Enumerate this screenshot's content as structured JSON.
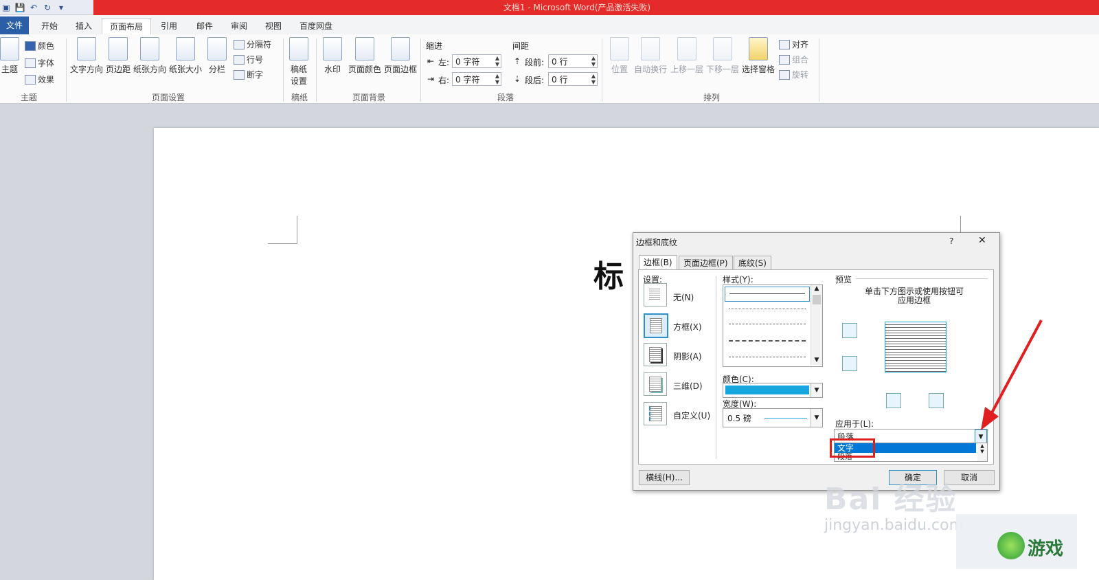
{
  "window": {
    "title": "文档1 - Microsoft Word(产品激活失败)"
  },
  "tabs": [
    "文件",
    "开始",
    "插入",
    "页面布局",
    "引用",
    "邮件",
    "审阅",
    "视图",
    "百度网盘"
  ],
  "ribbon": {
    "theme": {
      "big": "主题",
      "colors": "颜色",
      "fonts": "字体",
      "effects": "效果",
      "group": "主题"
    },
    "page_setup": {
      "text_dir": "文字方向",
      "margins": "页边距",
      "orientation": "纸张方向",
      "size": "纸张大小",
      "columns": "分栏",
      "breaks": "分隔符",
      "line_numbers": "行号",
      "hyphenation": "断字",
      "group": "页面设置"
    },
    "draft": {
      "btn1": "稿纸",
      "btn2": "设置",
      "group": "稿纸"
    },
    "bg": {
      "watermark": "水印",
      "page_color": "页面颜色",
      "page_border": "页面边框",
      "group": "页面背景"
    },
    "para": {
      "indent": "缩进",
      "left": "左:",
      "right": "右:",
      "left_val": "0 字符",
      "right_val": "0 字符",
      "spacing": "间距",
      "before": "段前:",
      "after": "段后:",
      "before_val": "0 行",
      "after_val": "0 行",
      "group": "段落"
    },
    "arrange": {
      "position": "位置",
      "wrap": "自动换行",
      "forward": "上移一层",
      "backward": "下移一层",
      "pane": "选择窗格",
      "align": "对齐",
      "group_btn": "组合",
      "rotate": "旋转",
      "group": "排列"
    }
  },
  "document": {
    "title_text": "标"
  },
  "dialog": {
    "title": "边框和底纹",
    "help": "?",
    "close": "✕",
    "tabs": [
      "边框(B)",
      "页面边框(P)",
      "底纹(S)"
    ],
    "settings_label": "设置:",
    "settings": [
      "无(N)",
      "方框(X)",
      "阴影(A)",
      "三维(D)",
      "自定义(U)"
    ],
    "style_label": "样式(Y):",
    "color_label": "颜色(C):",
    "width_label": "宽度(W):",
    "width_value": "0.5 磅",
    "preview_label": "预览",
    "preview_hint_1": "单击下方图示或使用按钮可",
    "preview_hint_2": "应用边框",
    "apply_label": "应用于(L):",
    "apply_value": "段落",
    "apply_options": [
      "文字",
      "段落"
    ],
    "hline_btn": "横线(H)...",
    "ok_btn": "确定",
    "cancel_btn": "取消",
    "accent_color": "#18a6e0"
  },
  "watermark": {
    "main": "Bai 经验",
    "sub": "jingyan.baidu.com",
    "logo": "游戏"
  }
}
